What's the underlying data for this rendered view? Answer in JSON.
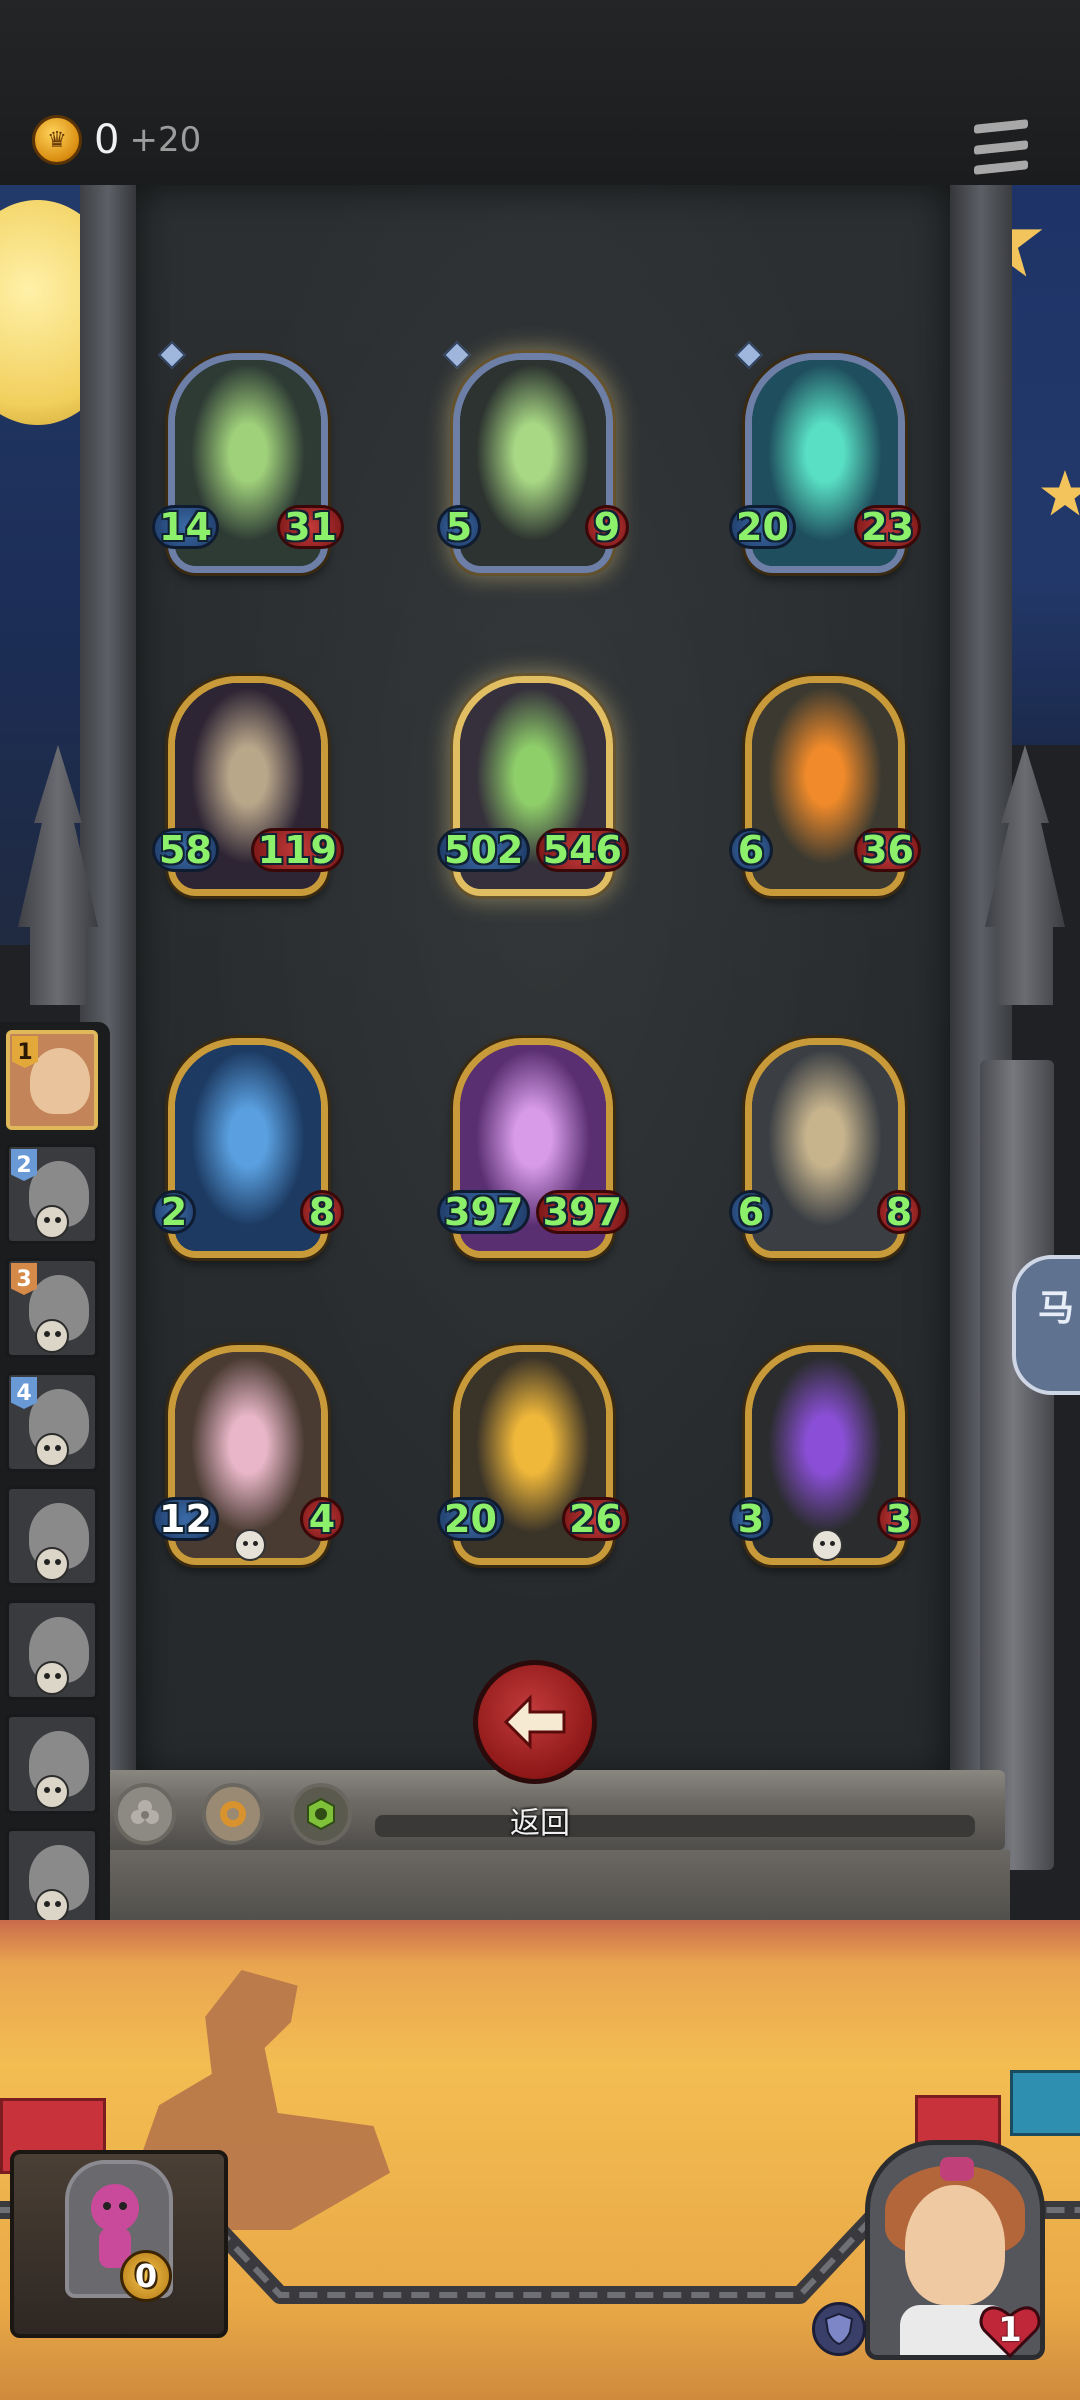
{
  "gold": {
    "value": "0",
    "bonus": "+20"
  },
  "cards": [
    {
      "atk": "14",
      "hp": "31",
      "variant": "blue",
      "art": "grim-reaper",
      "colors": [
        "#2e3b35",
        "#9fd07a"
      ]
    },
    {
      "atk": "5",
      "hp": "9",
      "variant": "golden blue",
      "art": "grim-reaper",
      "colors": [
        "#2c3330",
        "#a8d884"
      ]
    },
    {
      "atk": "20",
      "hp": "23",
      "variant": "blue",
      "art": "green-ghost",
      "colors": [
        "#1f4f5e",
        "#59e0c4"
      ]
    },
    {
      "atk": "58",
      "hp": "119",
      "variant": "",
      "art": "skeleton-dancer",
      "colors": [
        "#2d2434",
        "#b9a78a"
      ]
    },
    {
      "atk": "502",
      "hp": "546",
      "variant": "golden",
      "art": "hooded-lich",
      "colors": [
        "#35303b",
        "#8fcf6a"
      ]
    },
    {
      "atk": "6",
      "hp": "36",
      "variant": "",
      "art": "pumpkin-head",
      "colors": [
        "#3c3a30",
        "#f08a2a"
      ]
    },
    {
      "atk": "2",
      "hp": "8",
      "variant": "",
      "art": "mushroom-imp",
      "colors": [
        "#1c3a62",
        "#5aa0e0"
      ]
    },
    {
      "atk": "397",
      "hp": "397",
      "variant": "",
      "art": "sorceress",
      "colors": [
        "#5a2f72",
        "#d79be8"
      ]
    },
    {
      "atk": "6",
      "hp": "8",
      "variant": "",
      "art": "moth-beast",
      "colors": [
        "#3b3f44",
        "#c7b48d"
      ]
    },
    {
      "atk": "12",
      "hp": "4",
      "variant": "",
      "art": "scarecrow-girl",
      "colors": [
        "#4a3b32",
        "#e8b6c8"
      ],
      "skull": true,
      "atk_white": true
    },
    {
      "atk": "20",
      "hp": "26",
      "variant": "",
      "art": "cannon-beast",
      "colors": [
        "#3a3328",
        "#f0b83a"
      ]
    },
    {
      "atk": "3",
      "hp": "3",
      "variant": "",
      "art": "shadow-reaper",
      "colors": [
        "#2a2c2e",
        "#8a4fd6"
      ],
      "skull": true
    }
  ],
  "players": [
    {
      "rank": "1",
      "active": true
    },
    {
      "rank": "2"
    },
    {
      "rank": "3"
    },
    {
      "rank": "4"
    },
    {
      "rank": ""
    },
    {
      "rank": ""
    },
    {
      "rank": ""
    },
    {
      "rank": ""
    }
  ],
  "back": {
    "label": "返回"
  },
  "minions": {
    "count": "0"
  },
  "hero": {
    "life": "1"
  },
  "side_chip": {
    "label": "马"
  }
}
